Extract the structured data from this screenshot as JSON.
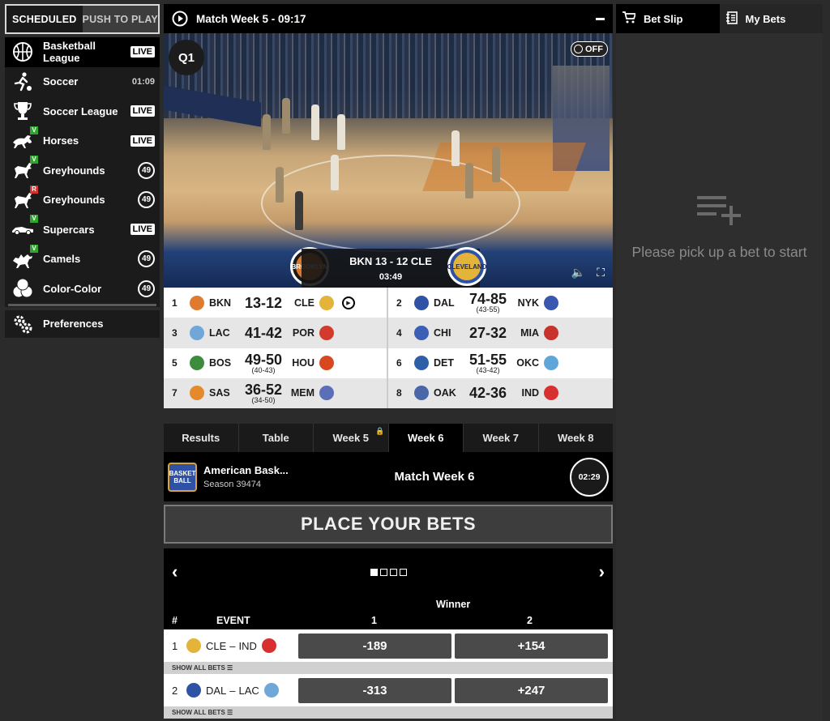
{
  "mode_tabs": {
    "scheduled": "SCHEDULED",
    "push_to_play": "PUSH TO PLAY"
  },
  "games": [
    {
      "name": "Basketball League",
      "badge": "LIVE",
      "icon": "basketball-icon"
    },
    {
      "name": "Soccer",
      "badge": "01:09",
      "icon": "soccer-player-icon"
    },
    {
      "name": "Soccer League",
      "badge": "LIVE",
      "icon": "trophy-icon"
    },
    {
      "name": "Horses",
      "badge": "LIVE",
      "icon": "horse-icon",
      "mini": "V"
    },
    {
      "name": "Greyhounds",
      "badge": "49",
      "icon": "greyhound-icon",
      "mini": "V"
    },
    {
      "name": "Greyhounds",
      "badge": "49",
      "icon": "greyhound-icon",
      "mini": "R"
    },
    {
      "name": "Supercars",
      "badge": "LIVE",
      "icon": "car-icon",
      "mini": "V"
    },
    {
      "name": "Camels",
      "badge": "49",
      "icon": "camel-icon",
      "mini": "V"
    },
    {
      "name": "Color-Color",
      "badge": "49",
      "icon": "balls-icon"
    }
  ],
  "preferences": "Preferences",
  "video": {
    "title": "Match Week 5 - 09:17",
    "quarter": "Q1",
    "toggle": "OFF",
    "home_logo_text": "BROOKLYN",
    "away_logo_text": "CLEVELAND",
    "score_line": "BKN  13 - 12  CLE",
    "clock": "03:49"
  },
  "matches": [
    {
      "idx": "1",
      "home": "BKN",
      "score": "13-12",
      "sub": "",
      "away": "CLE",
      "live": true
    },
    {
      "idx": "2",
      "home": "DAL",
      "score": "74-85",
      "sub": "(43-55)",
      "away": "NYK"
    },
    {
      "idx": "3",
      "home": "LAC",
      "score": "41-42",
      "sub": "",
      "away": "POR"
    },
    {
      "idx": "4",
      "home": "CHI",
      "score": "27-32",
      "sub": "",
      "away": "MIA"
    },
    {
      "idx": "5",
      "home": "BOS",
      "score": "49-50",
      "sub": "(40-43)",
      "away": "HOU"
    },
    {
      "idx": "6",
      "home": "DET",
      "score": "51-55",
      "sub": "(43-42)",
      "away": "OKC"
    },
    {
      "idx": "7",
      "home": "SAS",
      "score": "36-52",
      "sub": "(34-50)",
      "away": "MEM"
    },
    {
      "idx": "8",
      "home": "OAK",
      "score": "42-36",
      "sub": "",
      "away": "IND"
    }
  ],
  "week_tabs": [
    "Results",
    "Table",
    "Week 5",
    "Week 6",
    "Week 7",
    "Week 8"
  ],
  "league": {
    "logo_text": "BASKET BALL",
    "name": "American Bask...",
    "season": "Season 39474",
    "week": "Match Week 6",
    "countdown": "02:29"
  },
  "place_bets": "PLACE YOUR BETS",
  "pager": {
    "prev": "‹",
    "next": "›",
    "pages": 4,
    "current": 1
  },
  "odds": {
    "market": "Winner",
    "col_hash": "#",
    "col_event": "EVENT",
    "col_1": "1",
    "col_2": "2",
    "dash": "–",
    "show_all": "SHOW ALL BETS ☰",
    "rows": [
      {
        "idx": "1",
        "home": "CLE",
        "away": "IND",
        "odd1": "-189",
        "odd2": "+154"
      },
      {
        "idx": "2",
        "home": "DAL",
        "away": "LAC",
        "odd1": "-313",
        "odd2": "+247"
      }
    ]
  },
  "right": {
    "bet_slip": "Bet Slip",
    "my_bets": "My Bets",
    "empty_text": "Please pick up a bet to start"
  },
  "colors": {
    "live_badge": "#ffffff",
    "mini_v": "#2ea62e",
    "mini_r": "#d23232",
    "odd_button": "#4a4a4a"
  }
}
